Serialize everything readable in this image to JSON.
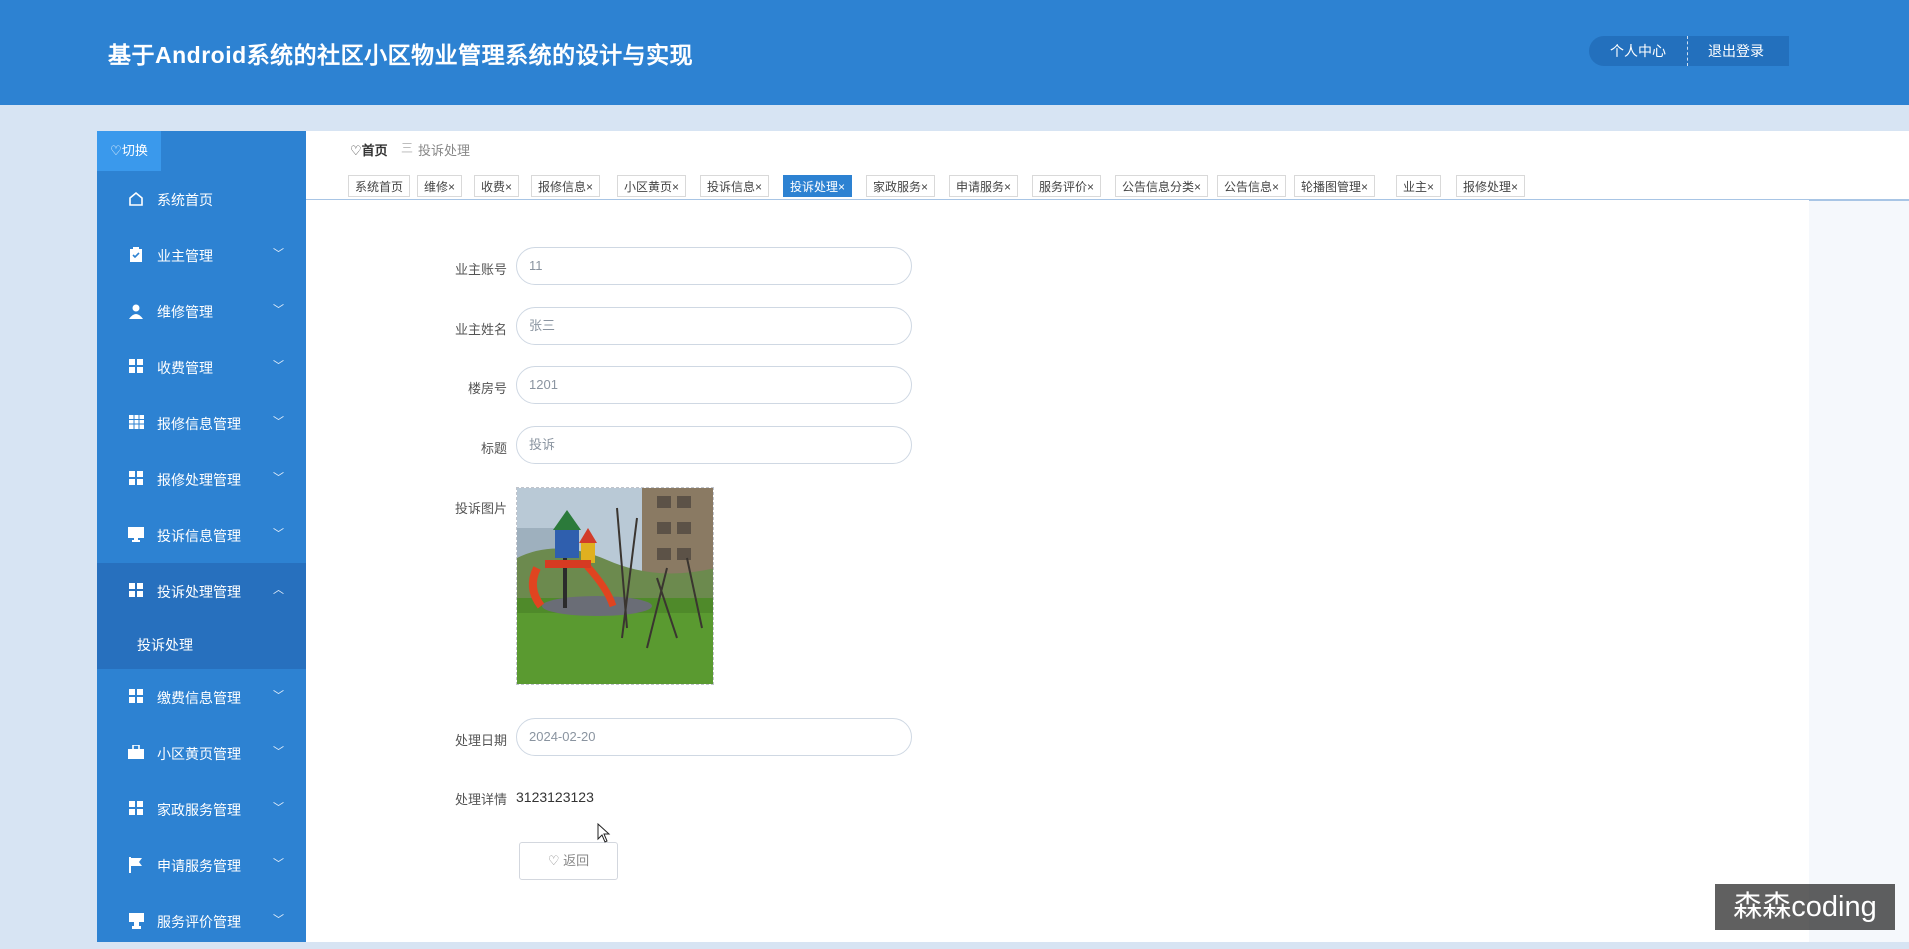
{
  "header": {
    "title": "基于Android系统的社区小区物业管理系统的设计与实现",
    "user_center": "个人中心",
    "logout": "退出登录"
  },
  "sidebar": {
    "switch_label": "切换",
    "items": [
      {
        "label": "系统首页",
        "icon": "home-icon"
      },
      {
        "label": "业主管理",
        "icon": "clipboard-icon"
      },
      {
        "label": "维修管理",
        "icon": "user-icon"
      },
      {
        "label": "收费管理",
        "icon": "grid-icon"
      },
      {
        "label": "报修信息管理",
        "icon": "table-icon"
      },
      {
        "label": "报修处理管理",
        "icon": "grid-icon"
      },
      {
        "label": "投诉信息管理",
        "icon": "monitor-icon"
      },
      {
        "label": "投诉处理管理",
        "icon": "grid-icon"
      },
      {
        "label": "缴费信息管理",
        "icon": "grid-icon"
      },
      {
        "label": "小区黄页管理",
        "icon": "briefcase-icon"
      },
      {
        "label": "家政服务管理",
        "icon": "grid-icon"
      },
      {
        "label": "申请服务管理",
        "icon": "flag-icon"
      },
      {
        "label": "服务评价管理",
        "icon": "cup-icon"
      }
    ],
    "submenu_item": "投诉处理"
  },
  "breadcrumb": {
    "home": "首页",
    "separator": "三",
    "current": "投诉处理"
  },
  "tabs": [
    {
      "label": "系统首页",
      "closable": false,
      "active": false
    },
    {
      "label": "维修",
      "closable": true,
      "active": false
    },
    {
      "label": "收费",
      "closable": true,
      "active": false
    },
    {
      "label": "报修信息",
      "closable": true,
      "active": false
    },
    {
      "label": "小区黄页",
      "closable": true,
      "active": false
    },
    {
      "label": "投诉信息",
      "closable": true,
      "active": false
    },
    {
      "label": "投诉处理",
      "closable": true,
      "active": true
    },
    {
      "label": "家政服务",
      "closable": true,
      "active": false
    },
    {
      "label": "申请服务",
      "closable": true,
      "active": false
    },
    {
      "label": "服务评价",
      "closable": true,
      "active": false
    },
    {
      "label": "公告信息分类",
      "closable": true,
      "active": false
    },
    {
      "label": "公告信息",
      "closable": true,
      "active": false
    },
    {
      "label": "轮播图管理",
      "closable": true,
      "active": false
    },
    {
      "label": "业主",
      "closable": true,
      "active": false
    },
    {
      "label": "报修处理",
      "closable": true,
      "active": false
    }
  ],
  "form": {
    "account_label": "业主账号",
    "account_value": "11",
    "name_label": "业主姓名",
    "name_value": "张三",
    "room_label": "楼房号",
    "room_value": "1201",
    "title_label": "标题",
    "title_value": "投诉",
    "image_label": "投诉图片",
    "date_label": "处理日期",
    "date_value": "2024-02-20",
    "detail_label": "处理详情",
    "detail_value": "3123123123",
    "back_button": "返回"
  },
  "watermark": "森森coding",
  "colors": {
    "primary": "#2d82d2",
    "sidebar_active": "#2770be",
    "page_bg": "#d7e4f3"
  }
}
